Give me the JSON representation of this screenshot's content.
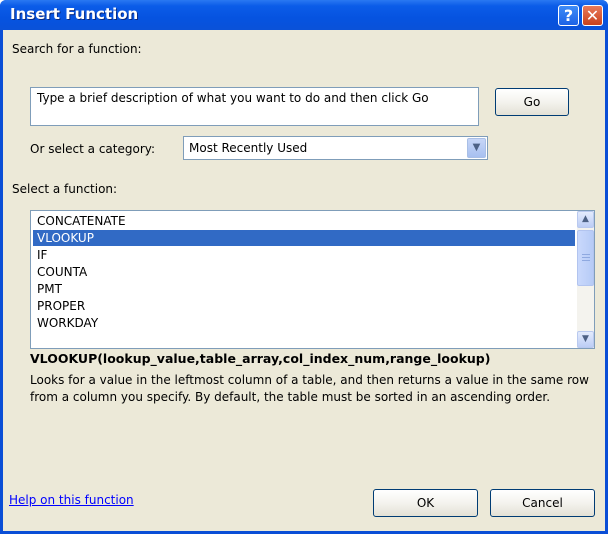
{
  "window": {
    "title": "Insert Function",
    "help_glyph": "?",
    "close_glyph": "✕"
  },
  "search": {
    "label": "Search for a function:",
    "value": "Type a brief description of what you want to do and then click Go",
    "go_label": "Go"
  },
  "category": {
    "label": "Or select a category:",
    "selected": "Most Recently Used"
  },
  "function_list": {
    "label": "Select a function:",
    "items": [
      "CONCATENATE",
      "VLOOKUP",
      "IF",
      "COUNTA",
      "PMT",
      "PROPER",
      "WORKDAY"
    ],
    "selected": "VLOOKUP"
  },
  "details": {
    "signature": "VLOOKUP(lookup_value,table_array,col_index_num,range_lookup)",
    "description": "Looks for a value in the leftmost column of a table, and then returns a value in the same row from a column you specify. By default, the table must be sorted in an ascending order."
  },
  "footer": {
    "help_link": "Help on this function",
    "ok_label": "OK",
    "cancel_label": "Cancel"
  },
  "colors": {
    "titlebar": "#0653e0",
    "selection": "#316ac5",
    "dialog_bg": "#ece9d8"
  }
}
